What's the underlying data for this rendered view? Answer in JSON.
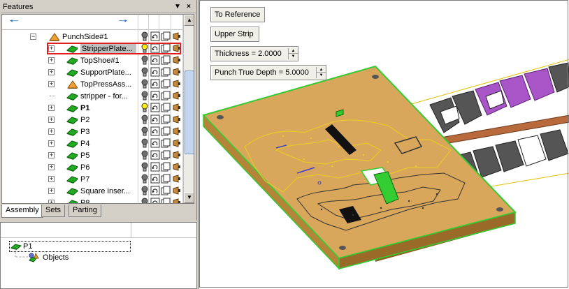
{
  "features_panel": {
    "title": "Features",
    "pin_icon": "pin-icon",
    "close_icon": "close-icon"
  },
  "tree": {
    "rows": [
      {
        "label": "PunchSide#1",
        "expander": "−",
        "icon": "assembly-cone-icon",
        "indent": 1,
        "bulb": "off",
        "bold": false
      },
      {
        "label": "StripperPlate...",
        "expander": "+",
        "icon": "plate-icon",
        "indent": 2,
        "bulb": "on",
        "bold": false,
        "selected": true
      },
      {
        "label": "TopShoe#1",
        "expander": "+",
        "icon": "plate-icon",
        "indent": 2,
        "bulb": "off",
        "bold": false
      },
      {
        "label": "SupportPlate...",
        "expander": "+",
        "icon": "plate-icon",
        "indent": 2,
        "bulb": "off",
        "bold": false
      },
      {
        "label": "TopPressAss...",
        "expander": "+",
        "icon": "assembly-cone-icon",
        "indent": 2,
        "bulb": "off",
        "bold": false
      },
      {
        "label": "stripper - for...",
        "expander": "",
        "icon": "plate-icon",
        "indent": 2,
        "bulb": "off",
        "bold": false
      },
      {
        "label": "P1",
        "expander": "+",
        "icon": "plate-icon",
        "indent": 2,
        "bulb": "on",
        "bold": true
      },
      {
        "label": "P2",
        "expander": "+",
        "icon": "plate-icon",
        "indent": 2,
        "bulb": "off",
        "bold": false
      },
      {
        "label": "P3",
        "expander": "+",
        "icon": "plate-icon",
        "indent": 2,
        "bulb": "off",
        "bold": false
      },
      {
        "label": "P4",
        "expander": "+",
        "icon": "plate-icon",
        "indent": 2,
        "bulb": "off",
        "bold": false
      },
      {
        "label": "P5",
        "expander": "+",
        "icon": "plate-icon",
        "indent": 2,
        "bulb": "off",
        "bold": false
      },
      {
        "label": "P6",
        "expander": "+",
        "icon": "plate-icon",
        "indent": 2,
        "bulb": "off",
        "bold": false
      },
      {
        "label": "P7",
        "expander": "+",
        "icon": "plate-icon",
        "indent": 2,
        "bulb": "off",
        "bold": false
      },
      {
        "label": "Square inser...",
        "expander": "+",
        "icon": "plate-icon",
        "indent": 2,
        "bulb": "off",
        "bold": false
      },
      {
        "label": "P8",
        "expander": "+",
        "icon": "plate-icon",
        "indent": 2,
        "bulb": "off",
        "bold": false
      }
    ]
  },
  "tabs": [
    {
      "label": "Assembly",
      "active": true
    },
    {
      "label": "Sets",
      "active": false
    },
    {
      "label": "Parting",
      "active": false
    }
  ],
  "objects": {
    "rows": [
      {
        "label": "P1",
        "icon": "plate-icon"
      },
      {
        "label": "Objects",
        "icon": "objects-icon"
      }
    ]
  },
  "viewport": {
    "to_reference": "To Reference",
    "upper_strip": "Upper Strip",
    "thickness_label": "Thickness =",
    "thickness_value": "2.0000",
    "punch_label": "Punch True Depth =",
    "punch_value": "5.0000"
  },
  "colors": {
    "plate": "#d9a75b",
    "plate_edge": "#33cc33",
    "selection": "#e02020",
    "purple": "#a855c8",
    "dark": "#555555"
  }
}
